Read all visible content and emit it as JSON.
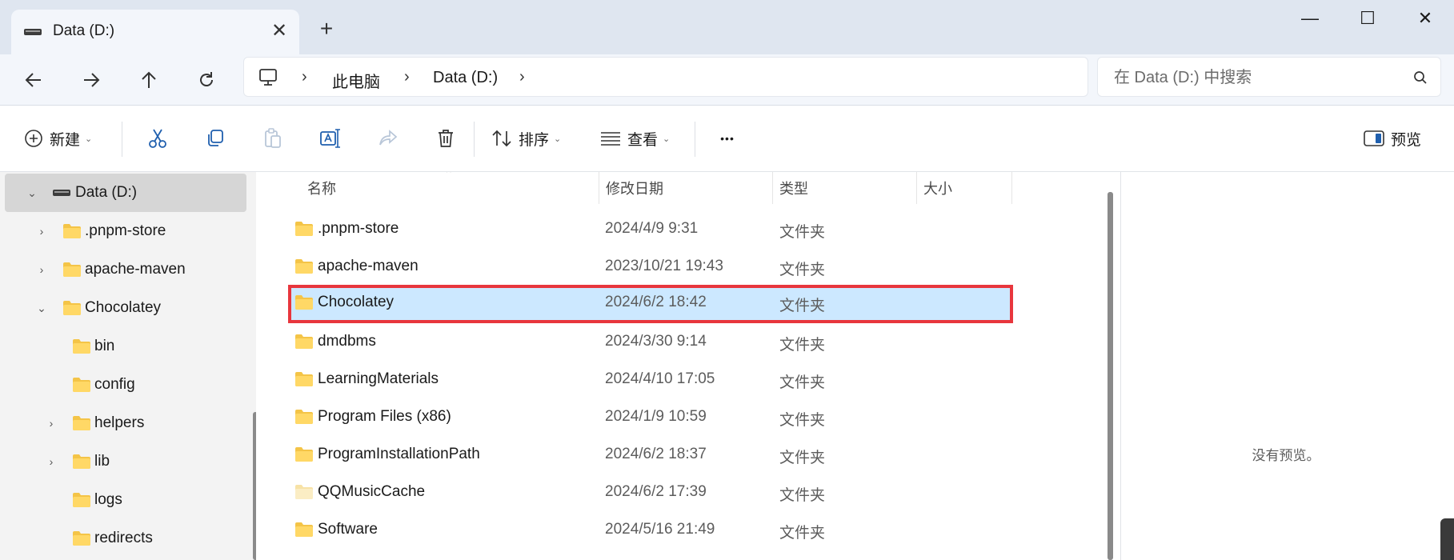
{
  "tab": {
    "title": "Data (D:)",
    "close": "✕",
    "new": "+"
  },
  "window": {
    "minimize": "—",
    "maximize": "☐",
    "close": "✕"
  },
  "breadcrumb": {
    "items": [
      "此电脑",
      "Data (D:)"
    ],
    "separator": "›"
  },
  "search": {
    "placeholder": "在 Data (D:) 中搜索",
    "value": ""
  },
  "commands": {
    "new_label": "新建",
    "sort_label": "排序",
    "view_label": "查看",
    "more_label": "•••",
    "preview_label": "预览"
  },
  "sidebar": {
    "items": [
      {
        "label": "Data (D:)",
        "expand": "⌄",
        "icon": "drive-icon"
      },
      {
        "label": ".pnpm-store",
        "expand": "›",
        "icon": "folder-icon"
      },
      {
        "label": "apache-maven",
        "expand": "›",
        "icon": "folder-icon"
      },
      {
        "label": "Chocolatey",
        "expand": "⌄",
        "icon": "folder-icon"
      },
      {
        "label": "bin",
        "expand": "",
        "icon": "folder-icon"
      },
      {
        "label": "config",
        "expand": "",
        "icon": "folder-icon"
      },
      {
        "label": "helpers",
        "expand": "›",
        "icon": "folder-icon"
      },
      {
        "label": "lib",
        "expand": "›",
        "icon": "folder-icon"
      },
      {
        "label": "logs",
        "expand": "",
        "icon": "folder-icon"
      },
      {
        "label": "redirects",
        "expand": "",
        "icon": "folder-icon"
      }
    ]
  },
  "columns": {
    "name": "名称",
    "date": "修改日期",
    "type": "类型",
    "size": "大小",
    "sort_indicator": "⌃"
  },
  "files": [
    {
      "name": ".pnpm-store",
      "date": "2024/4/9 9:31",
      "type": "文件夹"
    },
    {
      "name": "apache-maven",
      "date": "2023/10/21 19:43",
      "type": "文件夹"
    },
    {
      "name": "Chocolatey",
      "date": "2024/6/2 18:42",
      "type": "文件夹"
    },
    {
      "name": "dmdbms",
      "date": "2024/3/30 9:14",
      "type": "文件夹"
    },
    {
      "name": "LearningMaterials",
      "date": "2024/4/10 17:05",
      "type": "文件夹"
    },
    {
      "name": "Program Files (x86)",
      "date": "2024/1/9 10:59",
      "type": "文件夹"
    },
    {
      "name": "ProgramInstallationPath",
      "date": "2024/6/2 18:37",
      "type": "文件夹"
    },
    {
      "name": "QQMusicCache",
      "date": "2024/6/2 17:39",
      "type": "文件夹"
    },
    {
      "name": "Software",
      "date": "2024/5/16 21:49",
      "type": "文件夹"
    }
  ],
  "preview_pane": {
    "empty_text": "没有预览。"
  },
  "colors": {
    "selection": "#cce8ff",
    "highlight_border": "#e8363d",
    "folder": "#f4c447",
    "titlebar": "#dfe6f0"
  }
}
